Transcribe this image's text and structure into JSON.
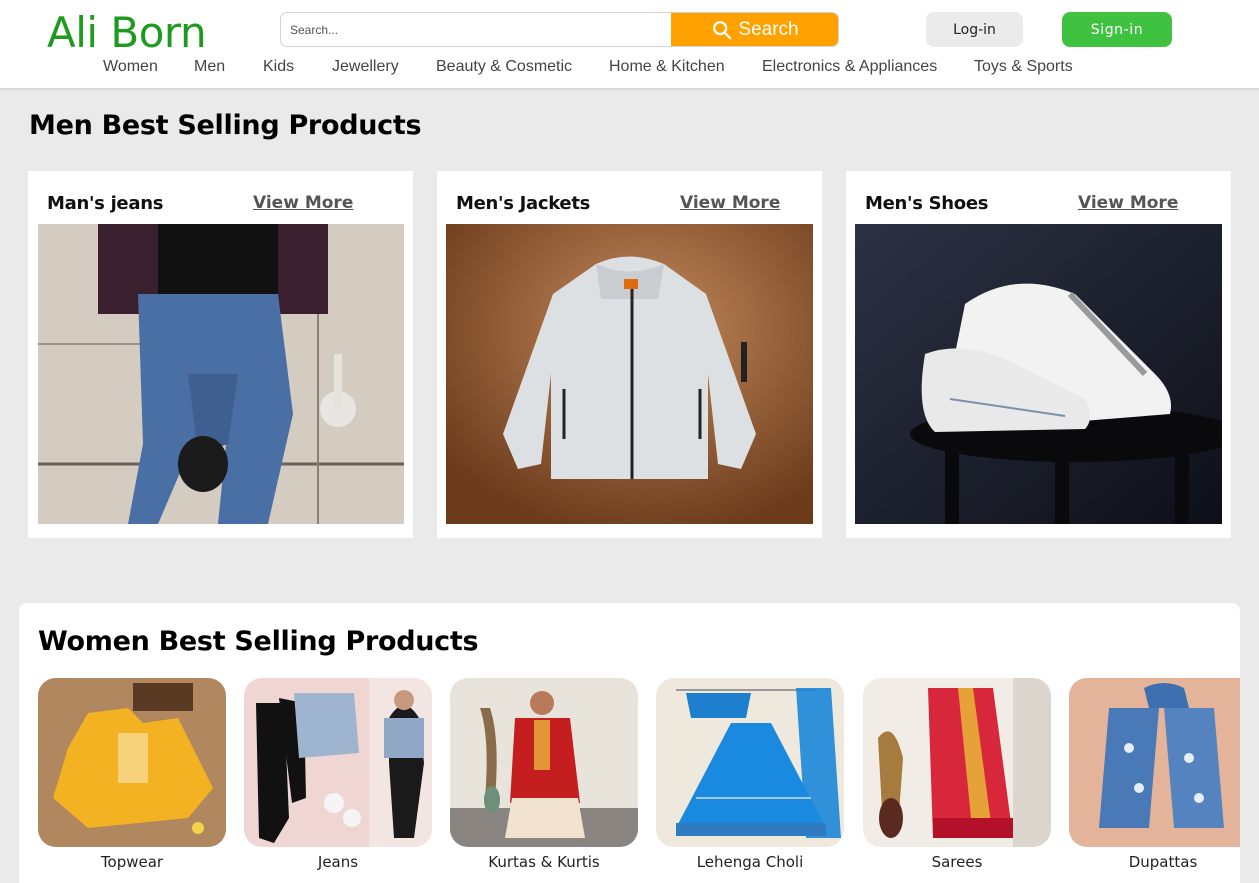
{
  "header": {
    "logo": "Ali Born",
    "search": {
      "placeholder": "Search...",
      "button_label": "Search"
    },
    "login_label": "Log-in",
    "signin_label": "Sign-in",
    "nav": [
      "Women",
      "Men",
      "Kids",
      "Jewellery",
      "Beauty & Cosmetic",
      "Home & Kitchen",
      "Electronics & Appliances",
      "Toys & Sports"
    ]
  },
  "men_section": {
    "title": "Men Best Selling Products",
    "cards": [
      {
        "title": "Man's jeans",
        "link": "View More",
        "image": "man-jeans-photo"
      },
      {
        "title": "Men's Jackets",
        "link": "View More",
        "image": "jacket-photo"
      },
      {
        "title": "Men's Shoes",
        "link": "View More",
        "image": "shoes-photo"
      }
    ]
  },
  "women_section": {
    "title": "Women Best Selling Products",
    "items": [
      {
        "label": "Topwear",
        "image": "topwear-photo"
      },
      {
        "label": "Jeans",
        "image": "jeans-photo"
      },
      {
        "label": "Kurtas & Kurtis",
        "image": "kurta-photo"
      },
      {
        "label": "Lehenga Choli",
        "image": "lehenga-photo"
      },
      {
        "label": "Sarees",
        "image": "saree-photo"
      },
      {
        "label": "Dupattas",
        "image": "dupatta-photo"
      }
    ]
  },
  "colors": {
    "brand": "#1e9a1e",
    "search_button": "#ffa200",
    "signin_button": "#3fc23f",
    "login_button": "#ebebeb",
    "page_bg": "#eaeaea"
  }
}
